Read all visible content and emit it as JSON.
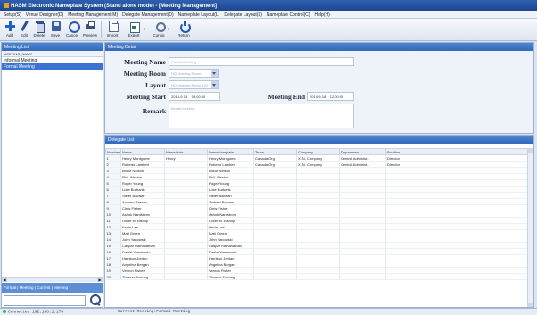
{
  "window": {
    "title": "HASM Electronic Nameplate System (Stand alone mode) - [Meeting Management]"
  },
  "menu": [
    "Setup(S)",
    "Venue Designer(D)",
    "Meeting Management(M)",
    "Delegate Management(D)",
    "Nameplate Layout(L)",
    "Delegate Layout(L)",
    "Nameplate Control(C)",
    "Help(H)"
  ],
  "toolbar": {
    "add": "Add",
    "edit": "Edit",
    "delete": "Delete",
    "save": "Save",
    "cancel": "Cancel",
    "preview": "Preview",
    "export": "Export",
    "import": "Import",
    "config": "Config",
    "return": "Return"
  },
  "meeting_list": {
    "header": "Meeting List",
    "column": "MEETING_NAME",
    "items": [
      {
        "label": "Informal Meeting",
        "selected": false
      },
      {
        "label": "Formal Meeting",
        "selected": true
      }
    ],
    "bottom_tabs": "Formal | Meeting | Current | Meeting"
  },
  "detail": {
    "header": "Meeting Detail",
    "meeting_name_label": "Meeting Name",
    "meeting_name_value": "Formal Meeting",
    "meeting_room_label": "Meeting Room",
    "meeting_room_value": "HQ Meeting Room",
    "layout_label": "Layout",
    "layout_value": "HQ Meeting Room 120",
    "start_label": "Meeting Start",
    "start_date": "2014-9-18",
    "start_time": "09:00:00",
    "end_label": "Meeting End",
    "end_date": "2014-9-18",
    "end_time": "12:00:00",
    "remark_label": "Remark",
    "remark_value": "formal meeting"
  },
  "delegates": {
    "header": "Delegate List",
    "columns": [
      "Number",
      "Name",
      "NameAbbr",
      "NameNamplate",
      "Team",
      "Company",
      "Department",
      "Position"
    ],
    "rows": [
      [
        "1",
        "Henry Montgome",
        "Henry",
        "Henry Montgome",
        "Canada Org",
        "X. N. Company",
        "Central Administ...",
        "Director"
      ],
      [
        "2",
        "Roberto Lambert",
        "",
        "Roberto Lambert",
        "Canada Org",
        "X. N. Company",
        "Central Administ...",
        "Director"
      ],
      [
        "3",
        "Bruce Nelson",
        "",
        "Bruce Nelson",
        "",
        "",
        "",
        ""
      ],
      [
        "4",
        "Phil. Weston",
        "",
        "Phil. Weston",
        "",
        "",
        "",
        ""
      ],
      [
        "5",
        "Roger Young",
        "",
        "Roger Young",
        "",
        "",
        "",
        ""
      ],
      [
        "6",
        "Luke Burbank",
        "",
        "Luke Burbank",
        "",
        "",
        "",
        ""
      ],
      [
        "7",
        "Steler Baldwin",
        "",
        "Steler Baldwin",
        "",
        "",
        "",
        ""
      ],
      [
        "8",
        "Andrew Reeves",
        "",
        "Andrew Reeves",
        "",
        "",
        "",
        ""
      ],
      [
        "9",
        "Chris Fisher",
        "",
        "Chris Fisher",
        "",
        "",
        "",
        ""
      ],
      [
        "10",
        "Ashok Nardstrom",
        "",
        "Ashok Nardstrom",
        "",
        "",
        "",
        ""
      ],
      [
        "11",
        "Oliver M. Bishop",
        "",
        "Oliver M. Bishop",
        "",
        "",
        "",
        ""
      ],
      [
        "12",
        "Kevin Lee",
        "",
        "Kevin Lee",
        "",
        "",
        "",
        ""
      ],
      [
        "13",
        "Matt Green",
        "",
        "Matt Green",
        "",
        "",
        "",
        ""
      ],
      [
        "14",
        "John Yanowski",
        "",
        "John Yanowski",
        "",
        "",
        "",
        ""
      ],
      [
        "15",
        "Caspar Ramanathan",
        "",
        "Caspar Ramanathan",
        "",
        "",
        "",
        ""
      ],
      [
        "16",
        "Daniel Yamamoto",
        "",
        "Daniel Yamamoto",
        "",
        "",
        "",
        ""
      ],
      [
        "17",
        "Harrison Jordan",
        "",
        "Harrison Jordan",
        "",
        "",
        "",
        ""
      ],
      [
        "18",
        "Angelina Bergan",
        "",
        "Angelina Bergan",
        "",
        "",
        "",
        ""
      ],
      [
        "19",
        "Vernon Fisher",
        "",
        "Vernon Fisher",
        "",
        "",
        "",
        ""
      ],
      [
        "20",
        "Thomas Furlong",
        "",
        "Thomas Furlong",
        "",
        "",
        "",
        ""
      ]
    ]
  },
  "status": {
    "connection": "Connected  192.168.1.176",
    "current_meeting": "Current Meeting:Formal Meeting"
  }
}
